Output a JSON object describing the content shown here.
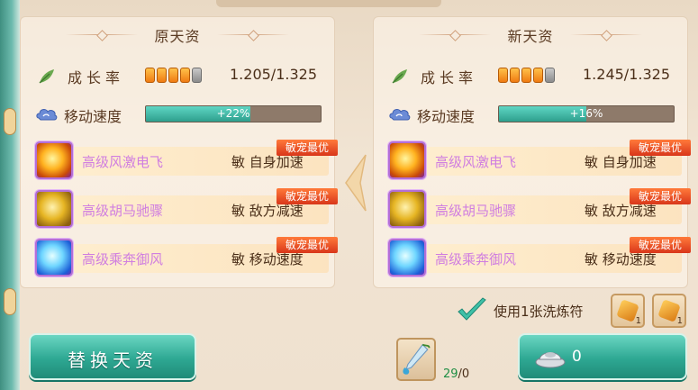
{
  "panels": [
    {
      "title": "原天资",
      "growth": {
        "label": "成长率",
        "value": "1.205/1.325",
        "stars_filled": 4,
        "stars_total": 5
      },
      "speed": {
        "label": "移动速度",
        "value": "+22%",
        "fill_fraction": 0.6
      },
      "skills": [
        {
          "name": "高级风激电飞",
          "attr": "敏 自身加速",
          "badge": "敏宠最优",
          "icon": "fire-dragon-icon"
        },
        {
          "name": "高级胡马驰骤",
          "attr": "敏 敌方减速",
          "badge": "敏宠最优",
          "icon": "golden-horse-icon"
        },
        {
          "name": "高级乘奔御风",
          "attr": "敏 移动速度",
          "badge": "敏宠最优",
          "icon": "ice-wind-icon"
        }
      ]
    },
    {
      "title": "新天资",
      "growth": {
        "label": "成长率",
        "value": "1.245/1.325",
        "stars_filled": 4,
        "stars_total": 5
      },
      "speed": {
        "label": "移动速度",
        "value": "+16%",
        "fill_fraction": 0.5
      },
      "skills": [
        {
          "name": "高级风激电飞",
          "attr": "敏 自身加速",
          "badge": "敏宠最优",
          "icon": "fire-dragon-icon"
        },
        {
          "name": "高级胡马驰骤",
          "attr": "敏 敌方减速",
          "badge": "敏宠最优",
          "icon": "golden-horse-icon"
        },
        {
          "name": "高级乘奔御风",
          "attr": "敏 移动速度",
          "badge": "敏宠最优",
          "icon": "ice-wind-icon"
        }
      ]
    }
  ],
  "wash": {
    "label": "使用1张洗炼符",
    "checked": true,
    "items": [
      {
        "count": "1"
      },
      {
        "count": "1"
      }
    ]
  },
  "replace_button": "替换天资",
  "item": {
    "have": "29",
    "need": "/0"
  },
  "cost_button": {
    "value": "0"
  },
  "colors": {
    "accent": "#2ea893",
    "skill_name": "#d07ee0",
    "badge": "#d9361a",
    "growth_star": "#f07b12"
  }
}
